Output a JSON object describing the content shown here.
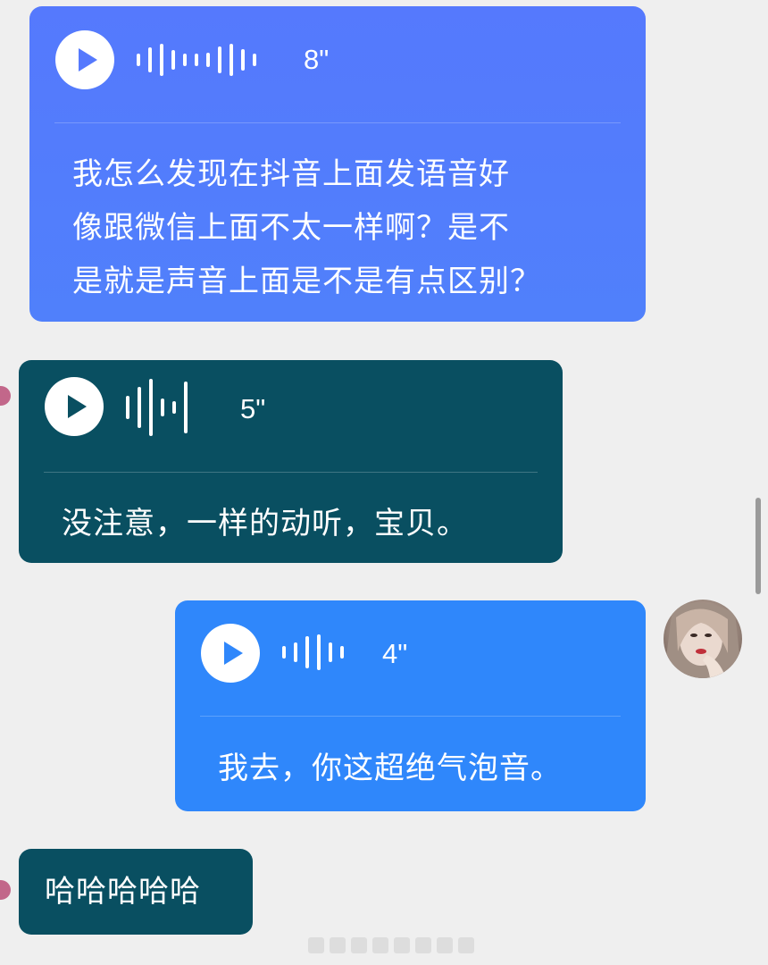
{
  "messages": [
    {
      "type": "voice",
      "duration": "8\"",
      "transcript_lines": [
        "我怎么发现在抖音上面发语音好",
        "像跟微信上面不太一样啊？是不",
        "是就是声音上面是不是有点区别？"
      ],
      "color": "#5579fd"
    },
    {
      "type": "voice",
      "duration": "5\"",
      "transcript_lines": [
        "没注意，一样的动听，宝贝。"
      ],
      "color": "#094f61"
    },
    {
      "type": "voice",
      "duration": "4\"",
      "transcript_lines": [
        "我去，你这超绝气泡音。"
      ],
      "color": "#2f87fb"
    },
    {
      "type": "text",
      "text": "哈哈哈哈哈",
      "color": "#094f61"
    }
  ],
  "icons": {
    "play": "play-icon",
    "waveform": "waveform-icon",
    "avatar": "user-avatar"
  },
  "colors": {
    "background": "#efefef",
    "text": "#ffffff"
  }
}
